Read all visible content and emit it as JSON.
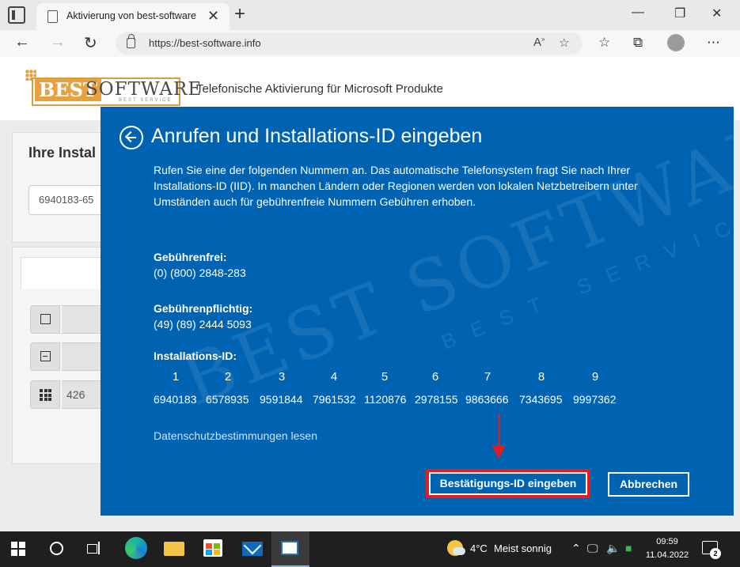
{
  "browser": {
    "tab_title": "Aktivierung von best-software",
    "url": "https://best-software.info"
  },
  "page": {
    "logo": {
      "best": "BEST",
      "software": "SOFTWARE",
      "subline": "BEST SERVICE"
    },
    "header_title": "Telefonische Aktivierung für Microsoft Produkte",
    "card_title": "Ihre Instal",
    "iid_input_value": "6940183-65",
    "field_value": "426"
  },
  "dialog": {
    "title": "Anrufen und Installations-ID eingeben",
    "intro": "Rufen Sie eine der folgenden Nummern an. Das automatische Telefonsystem fragt Sie nach Ihrer Installations-ID (IID). In manchen Ländern oder Regionen werden von lokalen Netzbetreibern unter Umständen auch für gebührenfreie Nummern Gebühren erhoben.",
    "tollfree_label": "Gebührenfrei:",
    "tollfree_number": "(0) (800) 2848-283",
    "toll_label": "Gebührenpflichtig:",
    "toll_number": "(49) (89) 2444 5093",
    "iid_label": "Installations-ID:",
    "iid_columns": [
      "1",
      "2",
      "3",
      "4",
      "5",
      "6",
      "7",
      "8",
      "9"
    ],
    "iid_values": [
      "6940183",
      "6578935",
      "9591844",
      "7961532",
      "1120876",
      "2978155",
      "9863666",
      "7343695",
      "9997362"
    ],
    "privacy_link": "Datenschutzbestimmungen lesen",
    "confirm_button": "Bestätigungs-ID eingeben",
    "cancel_button": "Abbrechen",
    "highlight_color": "#e31b23",
    "background_color": "#0063b1"
  },
  "watermark": {
    "text_large": "BEST SOFTWARE",
    "text_small": "BEST SERVICE"
  },
  "taskbar": {
    "weather_temp": "4°C",
    "weather_text": "Meist sonnig",
    "time": "09:59",
    "date": "11.04.2022",
    "notification_count": "2"
  }
}
